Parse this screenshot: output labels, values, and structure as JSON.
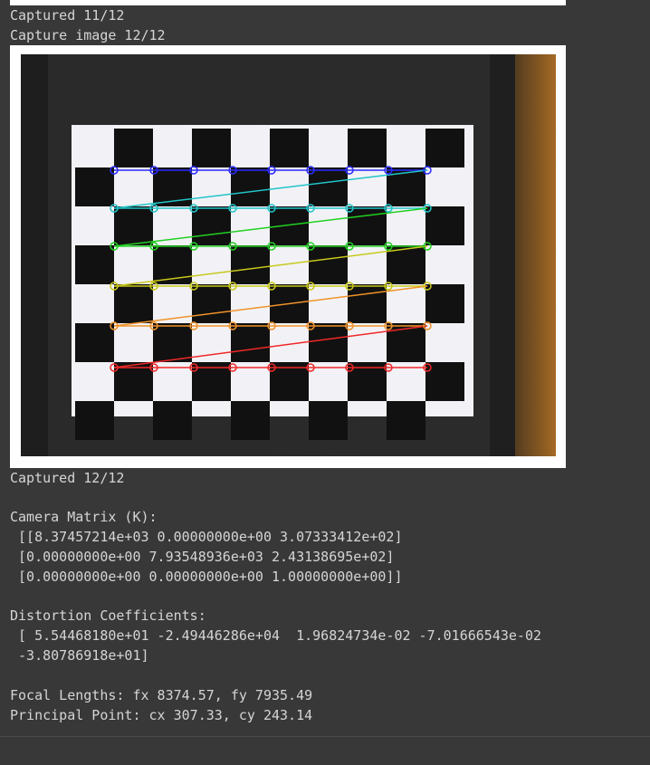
{
  "output": {
    "captured_11": "Captured 11/12",
    "capture_prompt_12": "Capture image 12/12",
    "captured_12": "Captured 12/12",
    "camera_matrix_header": "Camera Matrix (K):",
    "camera_matrix_rows": [
      " [[8.37457214e+03 0.00000000e+00 3.07333412e+02]",
      " [0.00000000e+00 7.93548936e+03 2.43138695e+02]",
      " [0.00000000e+00 0.00000000e+00 1.00000000e+00]]"
    ],
    "distortion_header": "Distortion Coefficients:",
    "distortion_rows": [
      " [ 5.54468180e+01 -2.49446286e+04  1.96824734e-02 -7.01666543e-02",
      " -3.80786918e+01]"
    ],
    "focal_lengths": "Focal Lengths: fx 8374.57, fy 7935.49",
    "principal_point": "Principal Point: cx 307.33, cy 243.14"
  },
  "colors": {
    "background": "#383838",
    "text": "#d5d5d5",
    "corner_rows": [
      "#2b2bff",
      "#21c4c8",
      "#22d022",
      "#c8c81c",
      "#f0922a",
      "#f02828"
    ]
  }
}
